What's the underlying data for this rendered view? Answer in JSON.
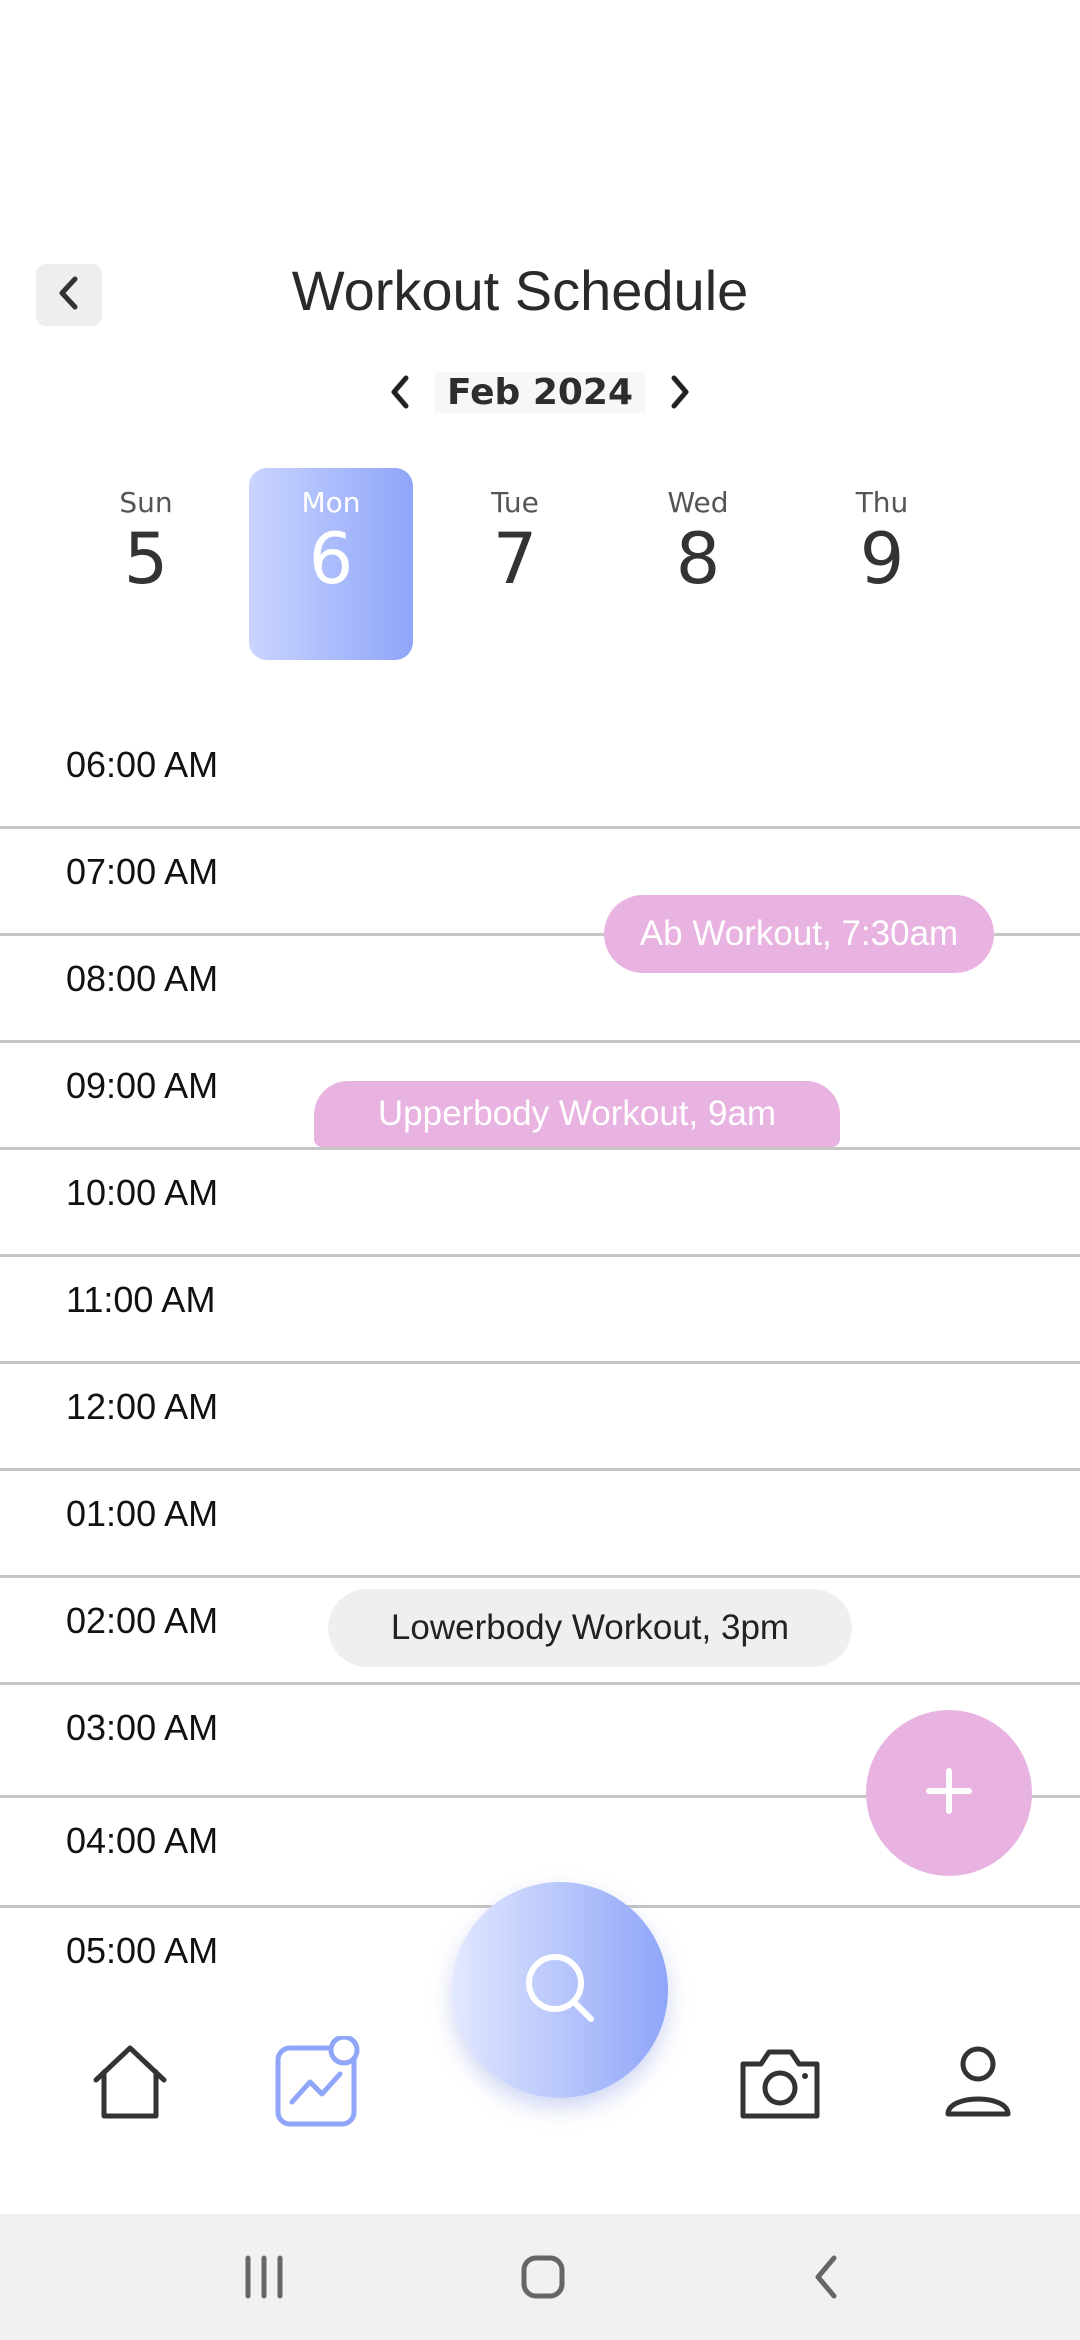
{
  "header": {
    "title": "Workout Schedule",
    "month": "Feb 2024"
  },
  "days": [
    {
      "name": "Sun",
      "num": "5"
    },
    {
      "name": "Mon",
      "num": "6",
      "selected": true
    },
    {
      "name": "Tue",
      "num": "7"
    },
    {
      "name": "Wed",
      "num": "8"
    },
    {
      "name": "Thu",
      "num": "9"
    }
  ],
  "times": [
    "06:00 AM",
    "07:00 AM",
    "08:00 AM",
    "09:00 AM",
    "10:00 AM",
    "11:00 AM",
    "12:00 AM",
    "01:00 AM",
    "02:00 AM",
    "03:00 AM",
    "04:00 AM",
    "05:00 AM"
  ],
  "events": [
    {
      "label": "Ab Workout, 7:30am",
      "style": "pink"
    },
    {
      "label": "Upperbody Workout, 9am",
      "style": "pink"
    },
    {
      "label": "Lowerbody Workout, 3pm",
      "style": "grey"
    }
  ],
  "colors": {
    "accent_pink": "#e8b3e0",
    "accent_blue": "#8fa5f8",
    "nav_active": "#8fa5f8"
  },
  "nav": [
    "home-icon",
    "progress-chart-icon",
    "search-icon",
    "camera-icon",
    "profile-icon"
  ]
}
